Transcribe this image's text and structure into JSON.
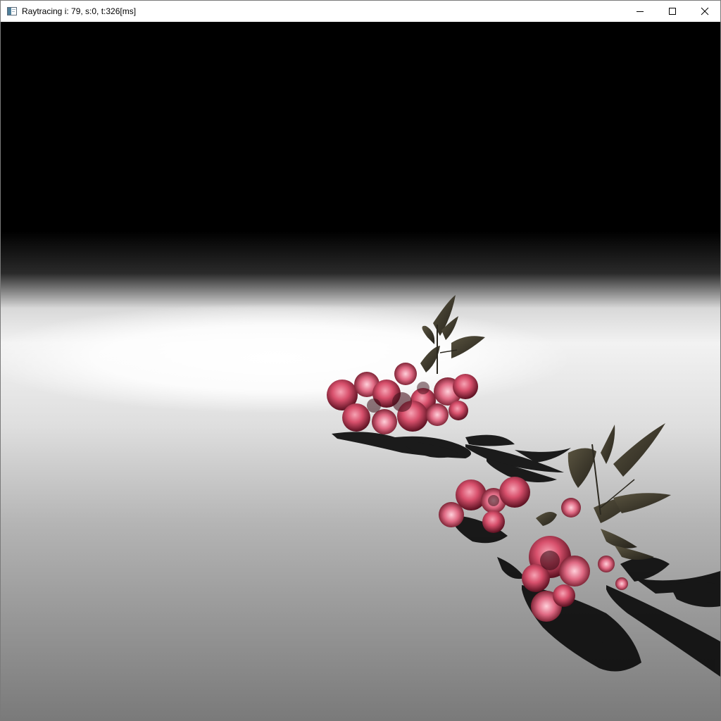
{
  "window": {
    "title": "Raytracing i: 79, s:0, t:326[ms]",
    "icons": {
      "app": "app-window-icon",
      "minimize": "minimize-icon",
      "maximize": "maximize-icon",
      "close": "close-icon"
    }
  },
  "colors": {
    "sky": "#000000",
    "floor_highlight": "#ffffff",
    "floor_far": "#7a7a7a",
    "petal": "#e0607a",
    "petal_dark": "#6a1626",
    "leaf": "#3f3a28",
    "shadow": "#0c0c0c"
  }
}
